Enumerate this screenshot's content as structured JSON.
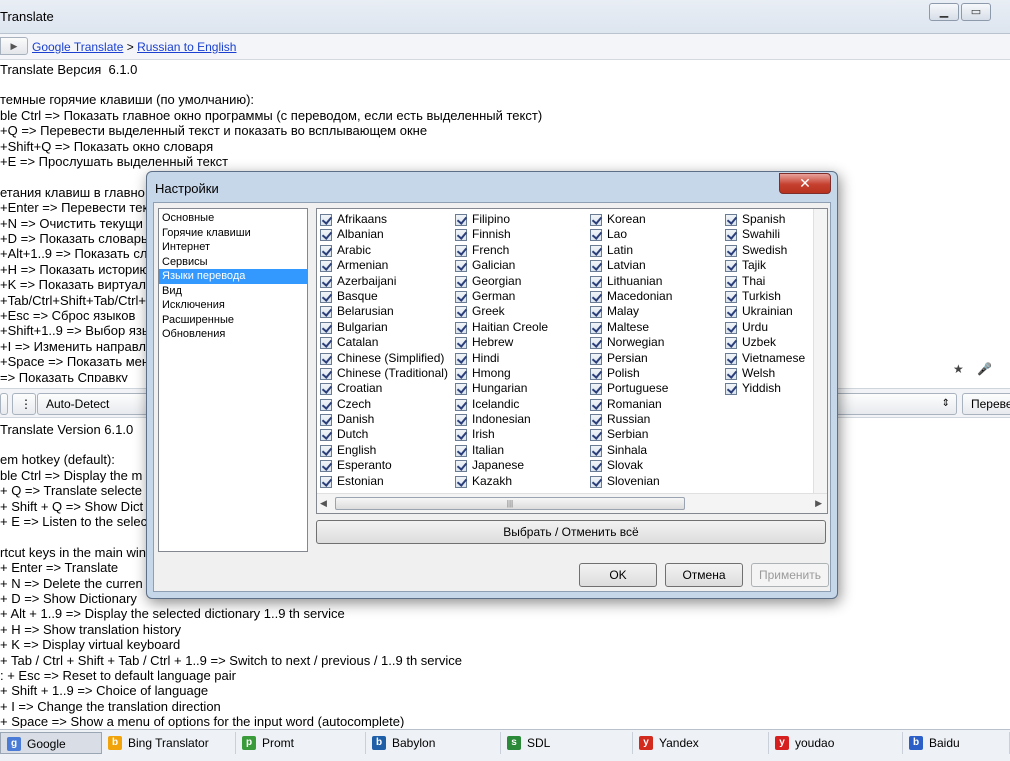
{
  "window": {
    "title": "Translate",
    "breadcrumb": {
      "part1": "Google Translate",
      "sep": ">",
      "part2": "Russian to English"
    }
  },
  "source_text": {
    "version": "Translate Версия  6.1.0",
    "lines": [
      "темные горячие клавиши (по умолчанию):",
      "ble Ctrl => Показать главное окно программы (с переводом, если есть выделенный текст)",
      "+Q => Перевести выделенный текст и показать во всплывающем окне",
      "+Shift+Q => Показать окно словаря",
      "+E => Прослушать выделенный текст",
      "",
      "етания клавиш в главно",
      "+Enter => Перевести тек",
      "+N => Очистить текущи",
      "+D => Показать словарь",
      "+Alt+1..9 => Показать сл",
      "+H => Показать историю",
      "+K => Показать виртуал",
      "+Tab/Ctrl+Shift+Tab/Ctrl+",
      "+Esc => Сброс языков",
      "+Shift+1..9 => Выбор язы",
      "+I => Изменить направл",
      "+Space => Показать мен",
      "=> Показать Справку"
    ]
  },
  "toolbar": {
    "source_lang": "Auto-Detect",
    "translate_btn": "Переве"
  },
  "target_text": {
    "version": "Translate Version 6.1.0",
    "lines": [
      "em hotkey (default):",
      "ble Ctrl => Display the m",
      "+ Q => Translate selecte",
      "+ Shift + Q => Show Dict",
      "+ E => Listen to the selec",
      "",
      "rtcut keys in the main win",
      "+ Enter => Translate",
      "+ N => Delete the curren",
      "+ D => Show Dictionary",
      "+ Alt + 1..9 => Display the selected dictionary 1..9 th service",
      "+ H => Show translation history",
      "+ K => Display virtual keyboard",
      "+ Tab / Ctrl + Shift + Tab / Ctrl + 1..9 => Switch to next / previous / 1..9 th service",
      ": + Esc => Reset to default language pair",
      "+ Shift + 1..9 => Choice of language",
      "+ I => Change the translation direction",
      "+ Space => Show a menu of options for the input word (autocomplete)"
    ]
  },
  "tabs": [
    {
      "label": "Google Translate",
      "icon": "google-icon",
      "color": "#4a7bd6"
    },
    {
      "label": "Bing Translator",
      "icon": "bing-icon",
      "color": "#f0a30a"
    },
    {
      "label": "Promt",
      "icon": "promt-icon",
      "color": "#3a9b3a"
    },
    {
      "label": "Babylon",
      "icon": "babylon-icon",
      "color": "#1f5fa8"
    },
    {
      "label": "SDL",
      "icon": "sdl-icon",
      "color": "#2a8a3a"
    },
    {
      "label": "Yandex",
      "icon": "yandex-icon",
      "color": "#d32a1e"
    },
    {
      "label": "youdao",
      "icon": "youdao-icon",
      "color": "#d62020"
    },
    {
      "label": "Baidu",
      "icon": "baidu-icon",
      "color": "#2b5fc7"
    }
  ],
  "dialog": {
    "title": "Настройки",
    "close": "✕",
    "categories": [
      "Основные",
      "Горячие клавиши",
      "Интернет",
      "Сервисы",
      "Языки перевода",
      "Вид",
      "Исключения",
      "Расширенные",
      "Обновления"
    ],
    "selected_category": "Языки перевода",
    "languages_col1": [
      "Afrikaans",
      "Albanian",
      "Arabic",
      "Armenian",
      "Azerbaijani",
      "Basque",
      "Belarusian",
      "Bulgarian",
      "Catalan",
      "Chinese (Simplified)",
      "Chinese (Traditional)",
      "Croatian",
      "Czech",
      "Danish",
      "Dutch",
      "English",
      "Esperanto",
      "Estonian"
    ],
    "languages_col2": [
      "Filipino",
      "Finnish",
      "French",
      "Galician",
      "Georgian",
      "German",
      "Greek",
      "Haitian Creole",
      "Hebrew",
      "Hindi",
      "Hmong",
      "Hungarian",
      "Icelandic",
      "Indonesian",
      "Irish",
      "Italian",
      "Japanese",
      "Kazakh"
    ],
    "languages_col3": [
      "Korean",
      "Lao",
      "Latin",
      "Latvian",
      "Lithuanian",
      "Macedonian",
      "Malay",
      "Maltese",
      "Norwegian",
      "Persian",
      "Polish",
      "Portuguese",
      "Romanian",
      "Russian",
      "Serbian",
      "Sinhala",
      "Slovak",
      "Slovenian"
    ],
    "languages_col4": [
      "Spanish",
      "Swahili",
      "Swedish",
      "Tajik",
      "Thai",
      "Turkish",
      "Ukrainian",
      "Urdu",
      "Uzbek",
      "Vietnamese",
      "Welsh",
      "Yiddish"
    ],
    "select_all": "Выбрать / Отменить всё",
    "ok": "OK",
    "cancel": "Отмена",
    "apply": "Применить"
  }
}
